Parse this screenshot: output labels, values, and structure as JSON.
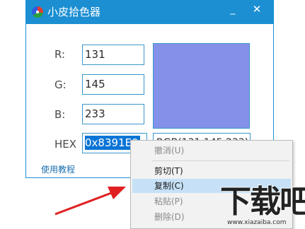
{
  "window": {
    "title": "小皮拾色器",
    "minimize_glyph": "_",
    "close_glyph": "✕"
  },
  "fields": {
    "r": {
      "label": "R:",
      "value": "131"
    },
    "g": {
      "label": "G:",
      "value": "145"
    },
    "b": {
      "label": "B:",
      "value": "233"
    },
    "hex": {
      "label": "HEX",
      "value": "0x8391E9"
    },
    "rgb_text": "RGB(131,145,233)"
  },
  "color_swatch": "#8391E9",
  "help_link": "使用教程",
  "context_menu": {
    "items": [
      {
        "label": "撤消(U)",
        "enabled": false
      },
      {
        "label": "剪切(T)",
        "enabled": true
      },
      {
        "label": "复制(C)",
        "enabled": true,
        "highlighted": true
      },
      {
        "label": "粘贴(P)",
        "enabled": false
      },
      {
        "label": "删除(D)",
        "enabled": false
      }
    ]
  },
  "watermark": {
    "logo": "下载吧",
    "url": "www.xiazaiba.com"
  },
  "colors": {
    "titlebar": "#1b8fd2",
    "accent_border": "#3a96c9",
    "selection": "#0a74d6",
    "menu_highlight": "#c6e1f7",
    "arrow": "#e02020"
  }
}
